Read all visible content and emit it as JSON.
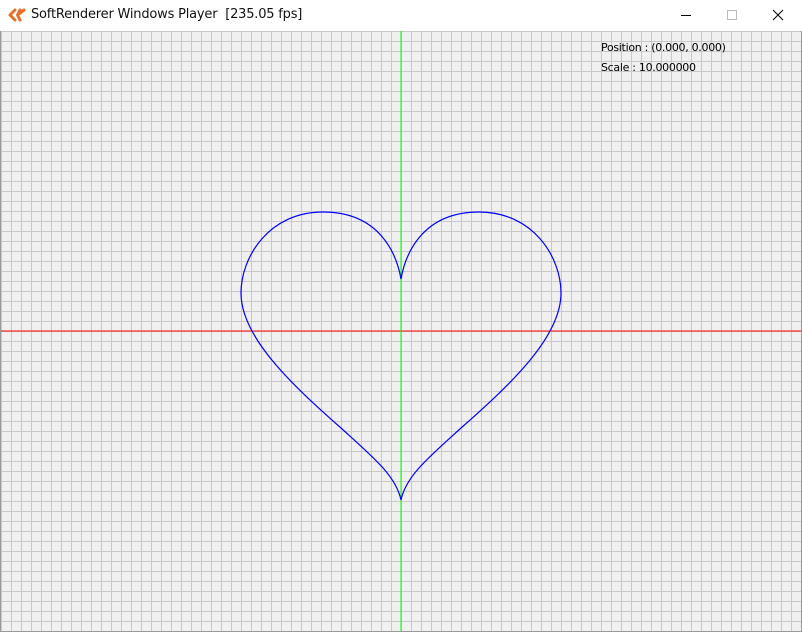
{
  "window": {
    "title": "SoftRenderer Windows Player  [235.05 fps]",
    "icon": "softrenderer-app-icon",
    "controls": {
      "minimize_icon": "minimize-icon",
      "maximize_icon": "maximize-icon",
      "close_icon": "close-icon"
    }
  },
  "viewport": {
    "position_text": "Position : (0.000, 0.000)",
    "scale_text": "Scale : 10.000000",
    "colors": {
      "background": "#f0f0f0",
      "grid": "#c8c8c8",
      "x_axis": "#ff0000",
      "y_axis": "#00ff00",
      "shape": "#0000ff"
    },
    "shape": "heart"
  }
}
